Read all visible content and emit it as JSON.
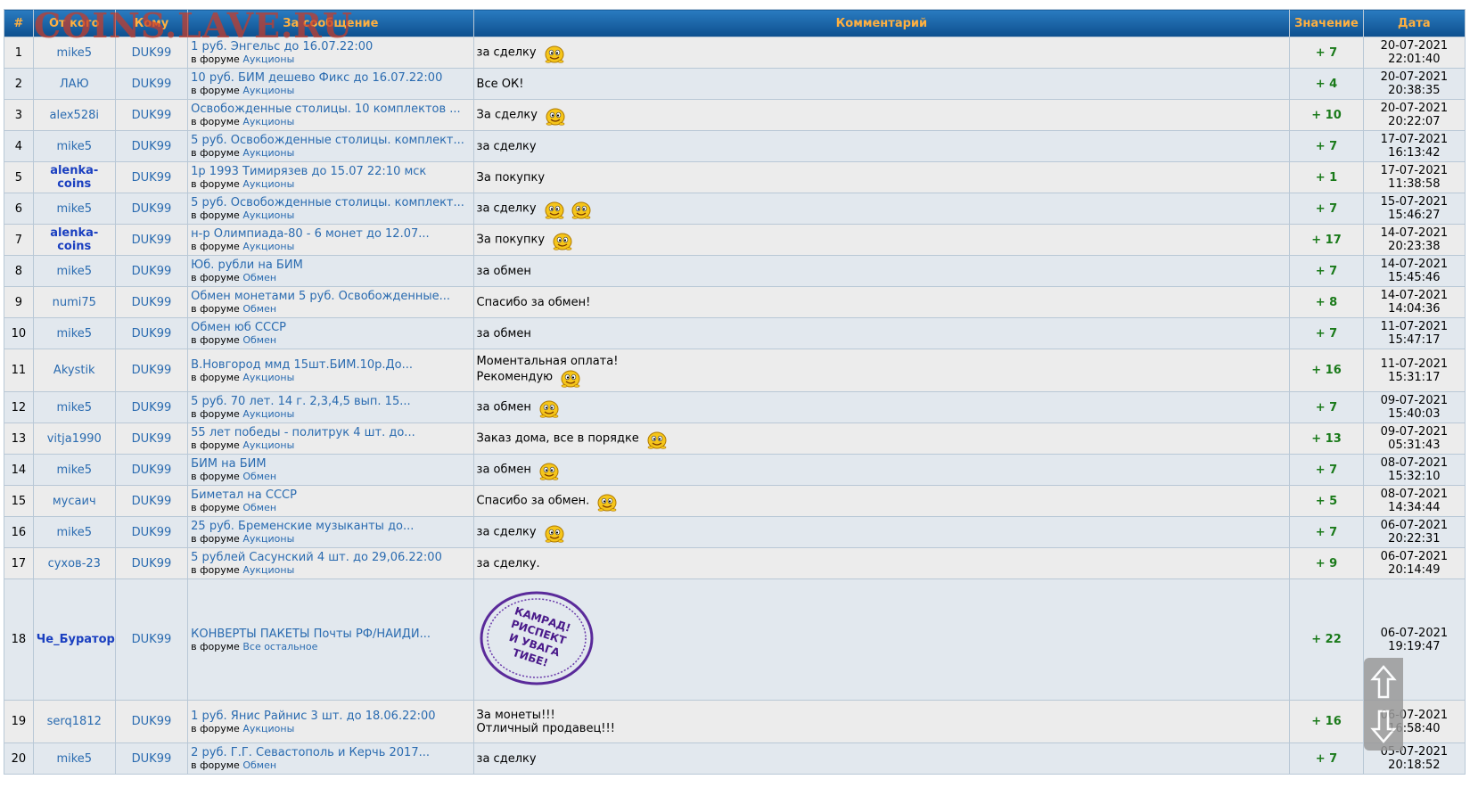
{
  "watermark": "COINS.LAVE.RU",
  "columns": [
    "#",
    "От кого",
    "Кому",
    "За сообщение",
    "Комментарий",
    "Значение",
    "Дата"
  ],
  "forum_prefix": "в форуме",
  "rows": [
    {
      "n": "1",
      "from": "mike5",
      "from_bold": false,
      "to": "DUK99",
      "topic": "1 руб. Энгельс до 16.07.22:00",
      "forum": "Аукционы",
      "comment": [
        "за сделку"
      ],
      "smiles": 1,
      "value": "+ 7",
      "date": "20-07-2021",
      "time": "22:01:40"
    },
    {
      "n": "2",
      "from": "ЛАЮ",
      "from_bold": false,
      "to": "DUK99",
      "topic": "10 руб. БИМ дешево Фикс до 16.07.22:00",
      "forum": "Аукционы",
      "comment": [
        "Все ОК!"
      ],
      "smiles": 0,
      "value": "+ 4",
      "date": "20-07-2021",
      "time": "20:38:35"
    },
    {
      "n": "3",
      "from": "alex528i",
      "from_bold": false,
      "to": "DUK99",
      "topic": "Освобожденные столицы. 10 комплектов ...",
      "forum": "Аукционы",
      "comment": [
        "За сделку"
      ],
      "smiles": 1,
      "value": "+ 10",
      "date": "20-07-2021",
      "time": "20:22:07"
    },
    {
      "n": "4",
      "from": "mike5",
      "from_bold": false,
      "to": "DUK99",
      "topic": "5 руб. Освобожденные столицы. комплект...",
      "forum": "Аукционы",
      "comment": [
        "за сделку"
      ],
      "smiles": 0,
      "value": "+ 7",
      "date": "17-07-2021",
      "time": "16:13:42"
    },
    {
      "n": "5",
      "from": "alenka-coins",
      "from_bold": true,
      "to": "DUK99",
      "topic": "1р 1993 Тимирязев до 15.07 22:10 мск",
      "forum": "Аукционы",
      "comment": [
        "За покупку"
      ],
      "smiles": 0,
      "value": "+ 1",
      "date": "17-07-2021",
      "time": "11:38:58"
    },
    {
      "n": "6",
      "from": "mike5",
      "from_bold": false,
      "to": "DUK99",
      "topic": "5 руб. Освобожденные столицы. комплект...",
      "forum": "Аукционы",
      "comment": [
        "за сделку"
      ],
      "smiles": 2,
      "value": "+ 7",
      "date": "15-07-2021",
      "time": "15:46:27"
    },
    {
      "n": "7",
      "from": "alenka-coins",
      "from_bold": true,
      "to": "DUK99",
      "topic": "н-р Олимпиада-80 - 6 монет до 12.07...",
      "forum": "Аукционы",
      "comment": [
        "За покупку"
      ],
      "smiles": 1,
      "value": "+ 17",
      "date": "14-07-2021",
      "time": "20:23:38"
    },
    {
      "n": "8",
      "from": "mike5",
      "from_bold": false,
      "to": "DUK99",
      "topic": "Юб. рубли на БИМ",
      "forum": "Обмен",
      "comment": [
        "за обмен"
      ],
      "smiles": 0,
      "value": "+ 7",
      "date": "14-07-2021",
      "time": "15:45:46"
    },
    {
      "n": "9",
      "from": "numi75",
      "from_bold": false,
      "to": "DUK99",
      "topic": "Обмен монетами 5 руб. Освобожденные...",
      "forum": "Обмен",
      "comment": [
        "Спасибо за обмен!"
      ],
      "smiles": 0,
      "value": "+ 8",
      "date": "14-07-2021",
      "time": "14:04:36"
    },
    {
      "n": "10",
      "from": "mike5",
      "from_bold": false,
      "to": "DUK99",
      "topic": "Обмен юб СССР",
      "forum": "Обмен",
      "comment": [
        "за обмен"
      ],
      "smiles": 0,
      "value": "+ 7",
      "date": "11-07-2021",
      "time": "15:47:17"
    },
    {
      "n": "11",
      "from": "Akystik",
      "from_bold": false,
      "to": "DUK99",
      "topic": "В.Новгород ммд 15шт.БИМ.10р.До...",
      "forum": "Аукционы",
      "comment": [
        "Моментальная оплата!",
        "Рекомендую"
      ],
      "smiles": 1,
      "value": "+ 16",
      "date": "11-07-2021",
      "time": "15:31:17"
    },
    {
      "n": "12",
      "from": "mike5",
      "from_bold": false,
      "to": "DUK99",
      "topic": "5 руб. 70 лет. 14 г. 2,3,4,5 вып. 15...",
      "forum": "Аукционы",
      "comment": [
        "за обмен"
      ],
      "smiles": 1,
      "value": "+ 7",
      "date": "09-07-2021",
      "time": "15:40:03"
    },
    {
      "n": "13",
      "from": "vitja1990",
      "from_bold": false,
      "to": "DUK99",
      "topic": "55 лет победы - политрук 4 шт. до...",
      "forum": "Аукционы",
      "comment": [
        "Заказ дома, все в порядке"
      ],
      "smiles": 1,
      "value": "+ 13",
      "date": "09-07-2021",
      "time": "05:31:43"
    },
    {
      "n": "14",
      "from": "mike5",
      "from_bold": false,
      "to": "DUK99",
      "topic": "БИМ на БИМ",
      "forum": "Обмен",
      "comment": [
        "за обмен"
      ],
      "smiles": 1,
      "value": "+ 7",
      "date": "08-07-2021",
      "time": "15:32:10"
    },
    {
      "n": "15",
      "from": "мусаич",
      "from_bold": false,
      "to": "DUK99",
      "topic": "Биметал на СССР",
      "forum": "Обмен",
      "comment": [
        "Спасибо за обмен."
      ],
      "smiles": 1,
      "value": "+ 5",
      "date": "08-07-2021",
      "time": "14:34:44"
    },
    {
      "n": "16",
      "from": "mike5",
      "from_bold": false,
      "to": "DUK99",
      "topic": "25 руб. Бременские музыканты до...",
      "forum": "Аукционы",
      "comment": [
        "за сделку"
      ],
      "smiles": 1,
      "value": "+ 7",
      "date": "06-07-2021",
      "time": "20:22:31"
    },
    {
      "n": "17",
      "from": "сухов-23",
      "from_bold": false,
      "to": "DUK99",
      "topic": "5 рублей Сасунский 4 шт. до 29,06.22:00",
      "forum": "Аукционы",
      "comment": [
        "за сделку."
      ],
      "smiles": 0,
      "value": "+ 9",
      "date": "06-07-2021",
      "time": "20:14:49"
    },
    {
      "n": "18",
      "from": "Че_Буратор",
      "from_bold": true,
      "to": "DUK99",
      "topic": "КОНВЕРТЫ ПАКЕТЫ Почты РФ/НАЙДИ...",
      "forum": "Все остальное",
      "comment": [],
      "stamp": [
        "КАМРАД!",
        "РИСПЕКТ",
        "И УВАГА",
        "ТИБЕ!"
      ],
      "smiles": 0,
      "value": "+ 22",
      "date": "06-07-2021",
      "time": "19:19:47"
    },
    {
      "n": "19",
      "from": "serq1812",
      "from_bold": false,
      "to": "DUK99",
      "topic": "1 руб. Янис Райнис 3 шт. до 18.06.22:00",
      "forum": "Аукционы",
      "comment": [
        "За монеты!!!",
        "Отличный продавец!!!"
      ],
      "smiles": 0,
      "value": "+ 16",
      "date": "06-07-2021",
      "time": "16:58:40"
    },
    {
      "n": "20",
      "from": "mike5",
      "from_bold": false,
      "to": "DUK99",
      "topic": "2 руб. Г.Г. Севастополь и Керчь 2017...",
      "forum": "Обмен",
      "comment": [
        "за сделку"
      ],
      "smiles": 0,
      "value": "+ 7",
      "date": "05-07-2021",
      "time": "20:18:52"
    }
  ],
  "scroll": {
    "up_icon": "arrow-up-icon",
    "down_icon": "arrow-down-icon"
  }
}
